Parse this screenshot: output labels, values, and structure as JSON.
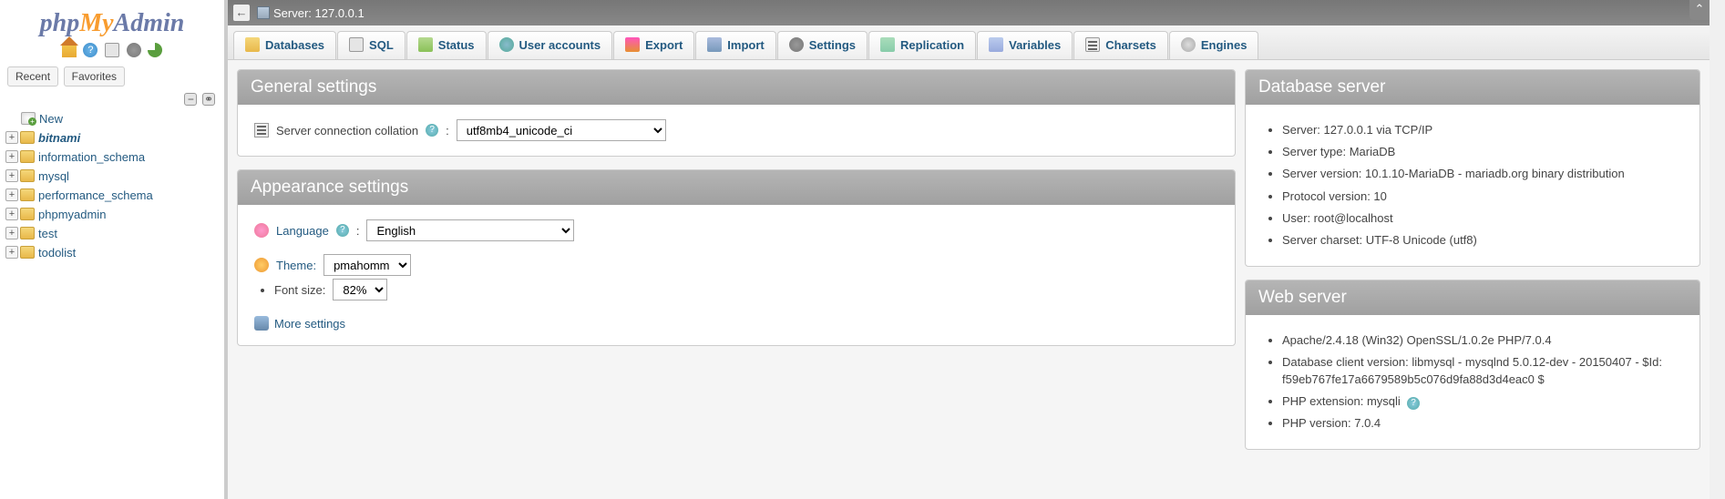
{
  "logo": {
    "php": "php",
    "my": "My",
    "admin": "Admin"
  },
  "sidebar": {
    "recent": "Recent",
    "favorites": "Favorites",
    "new": "New",
    "items": [
      {
        "label": "bitnami",
        "bold": true
      },
      {
        "label": "information_schema"
      },
      {
        "label": "mysql"
      },
      {
        "label": "performance_schema"
      },
      {
        "label": "phpmyadmin"
      },
      {
        "label": "test"
      },
      {
        "label": "todolist"
      }
    ]
  },
  "topbar": {
    "server_label": "Server: 127.0.0.1"
  },
  "tabs": [
    {
      "key": "db",
      "label": "Databases"
    },
    {
      "key": "sql",
      "label": "SQL"
    },
    {
      "key": "stat",
      "label": "Status"
    },
    {
      "key": "usr",
      "label": "User accounts"
    },
    {
      "key": "exp",
      "label": "Export"
    },
    {
      "key": "imp",
      "label": "Import"
    },
    {
      "key": "set",
      "label": "Settings"
    },
    {
      "key": "rep",
      "label": "Replication"
    },
    {
      "key": "var",
      "label": "Variables"
    },
    {
      "key": "chr",
      "label": "Charsets"
    },
    {
      "key": "eng",
      "label": "Engines"
    }
  ],
  "general": {
    "title": "General settings",
    "collation_label": "Server connection collation",
    "collation_value": "utf8mb4_unicode_ci"
  },
  "appearance": {
    "title": "Appearance settings",
    "language_label": "Language",
    "language_value": "English",
    "theme_label": "Theme:",
    "theme_value": "pmahomme",
    "fontsize_label": "Font size:",
    "fontsize_value": "82%",
    "more": "More settings"
  },
  "db_server": {
    "title": "Database server",
    "items": [
      "Server: 127.0.0.1 via TCP/IP",
      "Server type: MariaDB",
      "Server version: 10.1.10-MariaDB - mariadb.org binary distribution",
      "Protocol version: 10",
      "User: root@localhost",
      "Server charset: UTF-8 Unicode (utf8)"
    ]
  },
  "web_server": {
    "title": "Web server",
    "items": [
      "Apache/2.4.18 (Win32) OpenSSL/1.0.2e PHP/7.0.4",
      "Database client version: libmysql - mysqlnd 5.0.12-dev - 20150407 - $Id: f59eb767fe17a6679589b5c076d9fa88d3d4eac0 $",
      "PHP extension: mysqli",
      "PHP version: 7.0.4"
    ]
  }
}
